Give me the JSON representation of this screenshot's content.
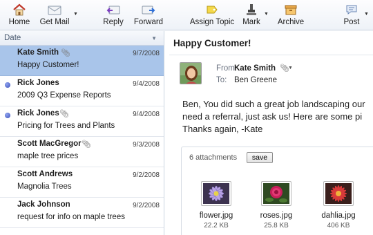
{
  "toolbar": {
    "home": "Home",
    "get_mail": "Get Mail",
    "reply": "Reply",
    "forward": "Forward",
    "assign_topic": "Assign Topic",
    "mark": "Mark",
    "archive": "Archive",
    "post": "Post"
  },
  "list": {
    "sort_label": "Date",
    "rows": [
      {
        "sender": "Kate Smith",
        "date": "9/7/2008",
        "subject": "Happy Customer!",
        "unread": false,
        "attachment": true
      },
      {
        "sender": "Rick Jones",
        "date": "9/4/2008",
        "subject": "2009 Q3 Expense Reports",
        "unread": true,
        "attachment": false
      },
      {
        "sender": "Rick Jones",
        "date": "9/4/2008",
        "subject": "Pricing for Trees and Plants",
        "unread": true,
        "attachment": true
      },
      {
        "sender": "Scott MacGregor",
        "date": "9/3/2008",
        "subject": "maple tree prices",
        "unread": false,
        "attachment": true
      },
      {
        "sender": "Scott Andrews",
        "date": "9/2/2008",
        "subject": "Magnolia Trees",
        "unread": false,
        "attachment": false
      },
      {
        "sender": "Jack Johnson",
        "date": "9/2/2008",
        "subject": "request for info on maple trees",
        "unread": false,
        "attachment": false
      }
    ]
  },
  "message": {
    "title": "Happy Customer!",
    "from_label": "From:",
    "from": "Kate Smith",
    "to_label": "To:",
    "to": "Ben Greene",
    "body_line1": "Ben, You did such a great job landscaping our",
    "body_line2": "need a referral, just ask us! Here are some pi",
    "body_line3": "Thanks again, -Kate",
    "attachments_label": "6 attachments",
    "save_label": "save",
    "attachments": [
      {
        "name": "flower.jpg",
        "size": "22.2 KB"
      },
      {
        "name": "roses.jpg",
        "size": "25.8 KB"
      },
      {
        "name": "dahlia.jpg",
        "size": "406 KB"
      }
    ]
  },
  "colors": {
    "selected_row": "#a9c5ea",
    "unread_dot": "#4a5fc9",
    "toolbar_bg": "#eef2f8"
  }
}
